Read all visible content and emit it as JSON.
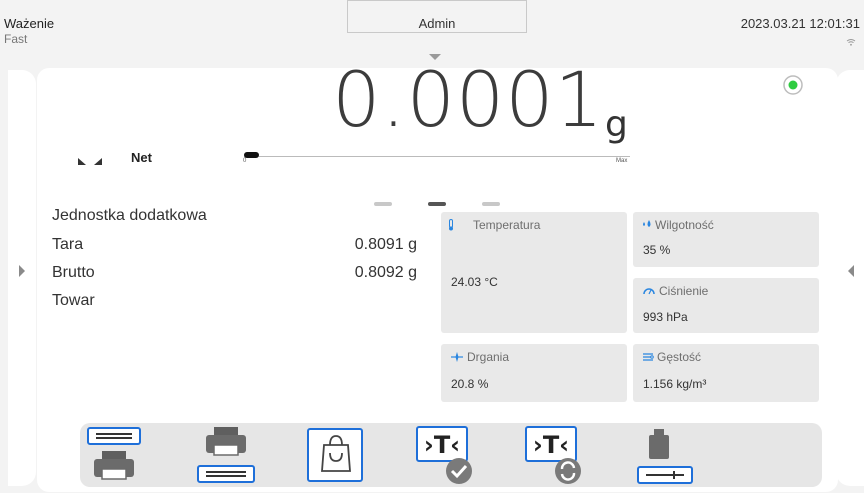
{
  "status": {
    "mode_title": "Ważenie",
    "mode_sub": "Fast",
    "user": "Admin",
    "datetime": "2023.03.21 12:01:31"
  },
  "readout": {
    "value": "0.0001",
    "unit": "g",
    "net_label": "Net",
    "bargraph_min": "0",
    "bargraph_max": "Max",
    "bargraph_fill_fraction": 0.04,
    "stable_color": "#2ecc40"
  },
  "pages": {
    "count": 3,
    "active_index": 1
  },
  "info": [
    {
      "label": "Jednostka dodatkowa",
      "value": ""
    },
    {
      "label": "Tara",
      "value": "0.8091 g"
    },
    {
      "label": "Brutto",
      "value": "0.8092 g"
    },
    {
      "label": "Towar",
      "value": ""
    }
  ],
  "sensors": {
    "temperature": {
      "label": "Temperatura",
      "value": "24.03 °C",
      "icon": "thermometer-icon"
    },
    "humidity": {
      "label": "Wilgotność",
      "value": "35 %",
      "icon": "humidity-drops-icon"
    },
    "pressure": {
      "label": "Ciśnienie",
      "value": "993 hPa",
      "icon": "pressure-gauge-icon"
    },
    "vibration": {
      "label": "Drgania",
      "value": "20.8 %",
      "icon": "vibration-icon"
    },
    "density": {
      "label": "Gęstość",
      "value": "1.156 kg/m³",
      "icon": "density-icon"
    }
  },
  "toolbar": [
    {
      "name": "header-print-button",
      "icon": "header-print-icon"
    },
    {
      "name": "footer-print-button",
      "icon": "footer-print-icon"
    },
    {
      "name": "product-button",
      "icon": "shopping-bag-icon"
    },
    {
      "name": "tare-confirm-button",
      "icon": "tare-check-icon"
    },
    {
      "name": "tare-reset-button",
      "icon": "tare-refresh-icon"
    },
    {
      "name": "weight-adjust-button",
      "icon": "weight-adjust-icon"
    }
  ],
  "colors": {
    "accent": "#1e6fd9",
    "tile_bg": "#e9e9e9",
    "icon_blue": "#2a86e0"
  }
}
